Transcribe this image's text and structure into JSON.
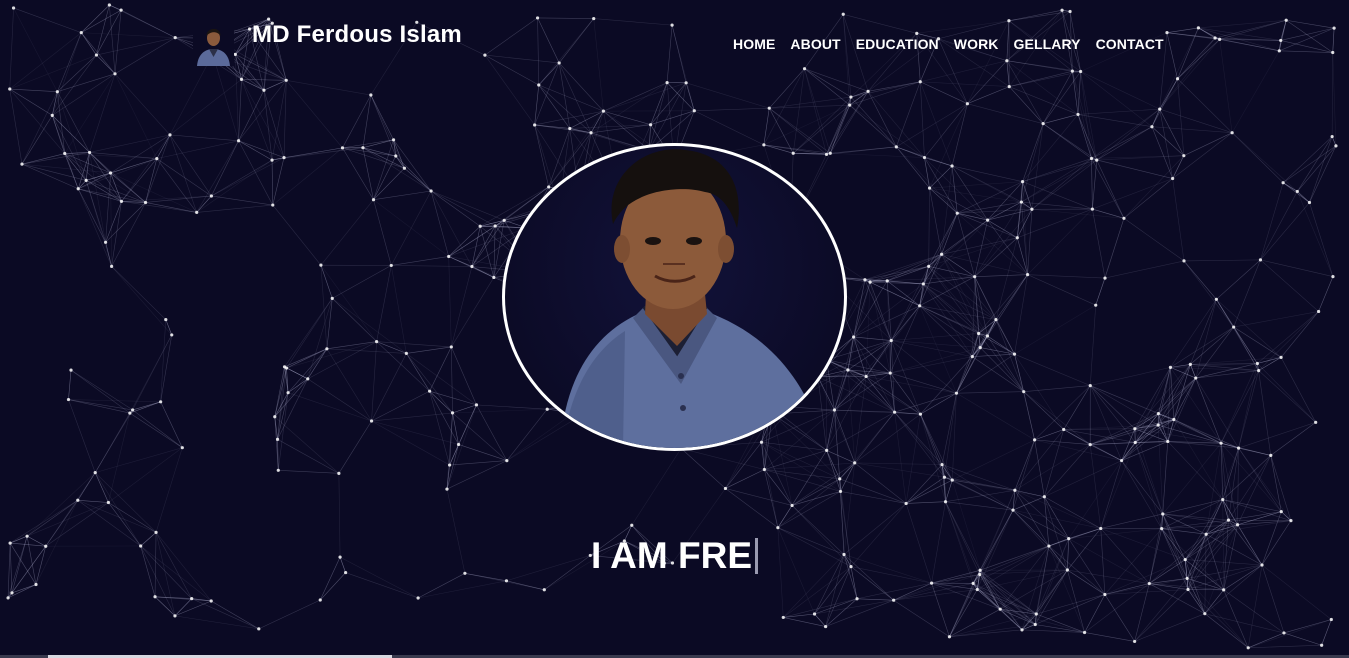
{
  "brand": {
    "name": "MD Ferdous Islam",
    "avatar_icon": "avatar-photo"
  },
  "nav": {
    "items": [
      {
        "label": "HOME"
      },
      {
        "label": "ABOUT"
      },
      {
        "label": "EDUCATION"
      },
      {
        "label": "WORK"
      },
      {
        "label": "GELLARY"
      },
      {
        "label": "CONTACT"
      }
    ]
  },
  "hero": {
    "typed_text": "I AM FRE",
    "portrait_icon": "profile-photo"
  },
  "colors": {
    "background": "#0b0a24",
    "text": "#ffffff",
    "network_line": "#b8b8d8",
    "portrait_border": "#ffffff"
  }
}
